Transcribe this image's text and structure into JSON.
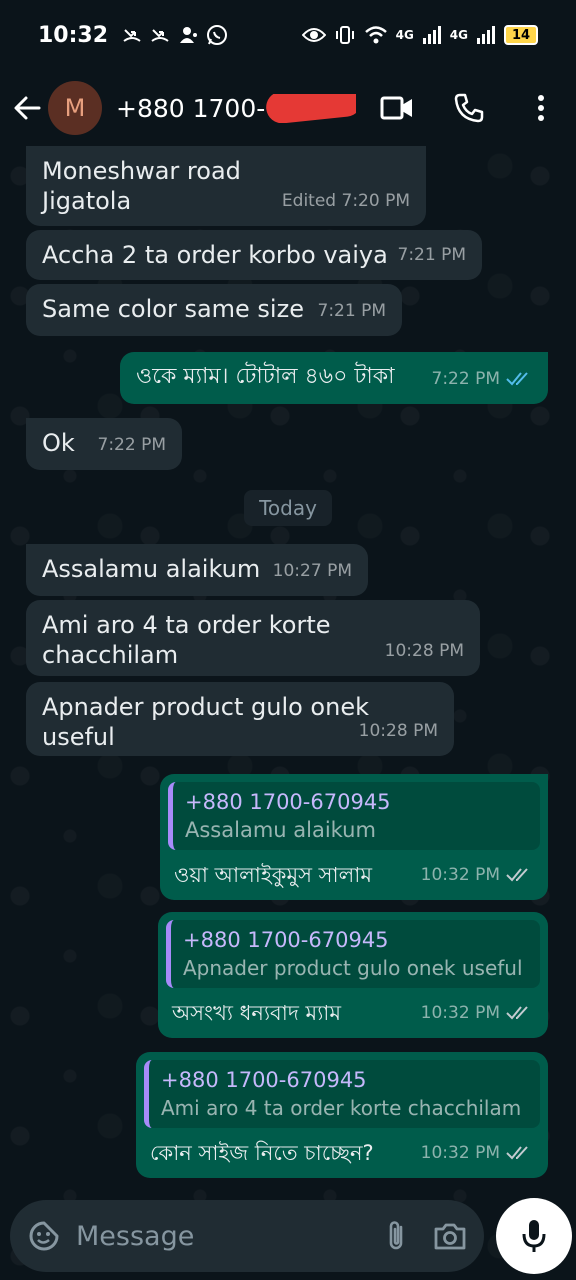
{
  "status_bar": {
    "time": "10:32",
    "network_1": "4G",
    "network_2": "4G",
    "battery": "14"
  },
  "header": {
    "avatar_letter": "M",
    "contact_name": "+880 1700-67"
  },
  "messages": [
    {
      "dir": "in",
      "text": "Moneshwar road\nJigatola",
      "time": "Edited 7:20 PM"
    },
    {
      "dir": "in",
      "text": "Accha 2 ta order korbo vaiya",
      "time": "7:21 PM"
    },
    {
      "dir": "in",
      "text": "Same color same size",
      "time": "7:21 PM"
    },
    {
      "dir": "out",
      "text": "ওকে ম্যাম। টোটাল ৪৬০ টাকা",
      "time": "7:22 PM"
    },
    {
      "dir": "in",
      "text": "Ok",
      "time": "7:22 PM"
    },
    {
      "dir": "in",
      "text": "Assalamu alaikum",
      "time": "10:27 PM"
    },
    {
      "dir": "in",
      "text": "Ami aro 4 ta order korte chacchilam",
      "time": "10:28 PM"
    },
    {
      "dir": "in",
      "text": "Apnader product gulo onek useful",
      "time": "10:28 PM"
    },
    {
      "dir": "out",
      "quote_author": "+880 1700-670945",
      "quote_text": "Assalamu alaikum",
      "text": "ওয়া আলাইকুমুস সালাম",
      "time": "10:32 PM"
    },
    {
      "dir": "out",
      "quote_author": "+880 1700-670945",
      "quote_text": "Apnader product gulo onek useful",
      "text": "অসংখ্য ধন্যবাদ ম্যাম",
      "time": "10:32 PM"
    },
    {
      "dir": "out",
      "quote_author": "+880 1700-670945",
      "quote_text": "Ami aro 4 ta order korte chacchilam",
      "text": "কোন সাইজ নিতে চাচ্ছেন?",
      "time": "10:32 PM"
    }
  ],
  "day_separator": "Today",
  "input": {
    "placeholder": "Message"
  },
  "colors": {
    "background": "#0b141a",
    "incoming_bubble": "#202c33",
    "outgoing_bubble": "#005c4b",
    "read_tick": "#53bdeb",
    "quote_bar": "#a78bfa"
  }
}
